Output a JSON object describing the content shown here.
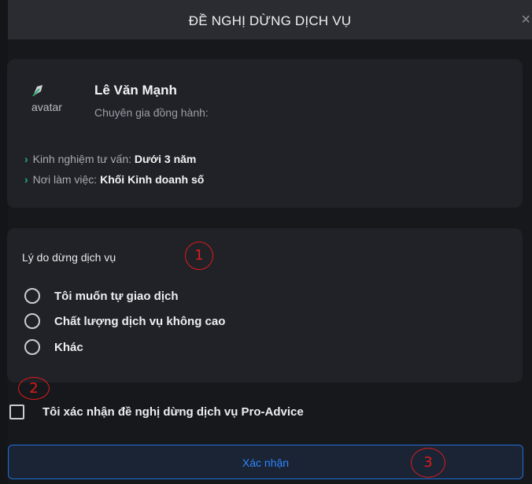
{
  "modal": {
    "title": "ĐỀ NGHỊ DỪNG DỊCH VỤ",
    "close_icon": "×"
  },
  "advisor": {
    "avatar_alt": "avatar",
    "avatar_icon": "broken-image-icon",
    "name": "Lê Văn Mạnh",
    "role": "Chuyên gia đồng hành:",
    "info": [
      {
        "label": "Kinh nghiệm tư vấn:",
        "value": "Dưới 3 năm"
      },
      {
        "label": "Nơi làm việc:",
        "value": "Khối Kinh doanh số"
      }
    ],
    "bullet_icon": "›"
  },
  "reason": {
    "title": "Lý do dừng dịch vụ",
    "options": [
      {
        "label": "Tôi muốn tự giao dịch",
        "selected": false
      },
      {
        "label": "Chất lượng dịch vụ không cao",
        "selected": false
      },
      {
        "label": "Khác",
        "selected": false
      }
    ]
  },
  "confirm": {
    "label": "Tôi xác nhận đề nghị dừng dịch vụ Pro-Advice",
    "checked": false
  },
  "submit": {
    "label": "Xác nhận"
  },
  "annotations": [
    "1",
    "2",
    "3"
  ],
  "colors": {
    "accent": "#2f86ff",
    "bullet": "#22b27a",
    "annotation": "#e01b1b"
  }
}
